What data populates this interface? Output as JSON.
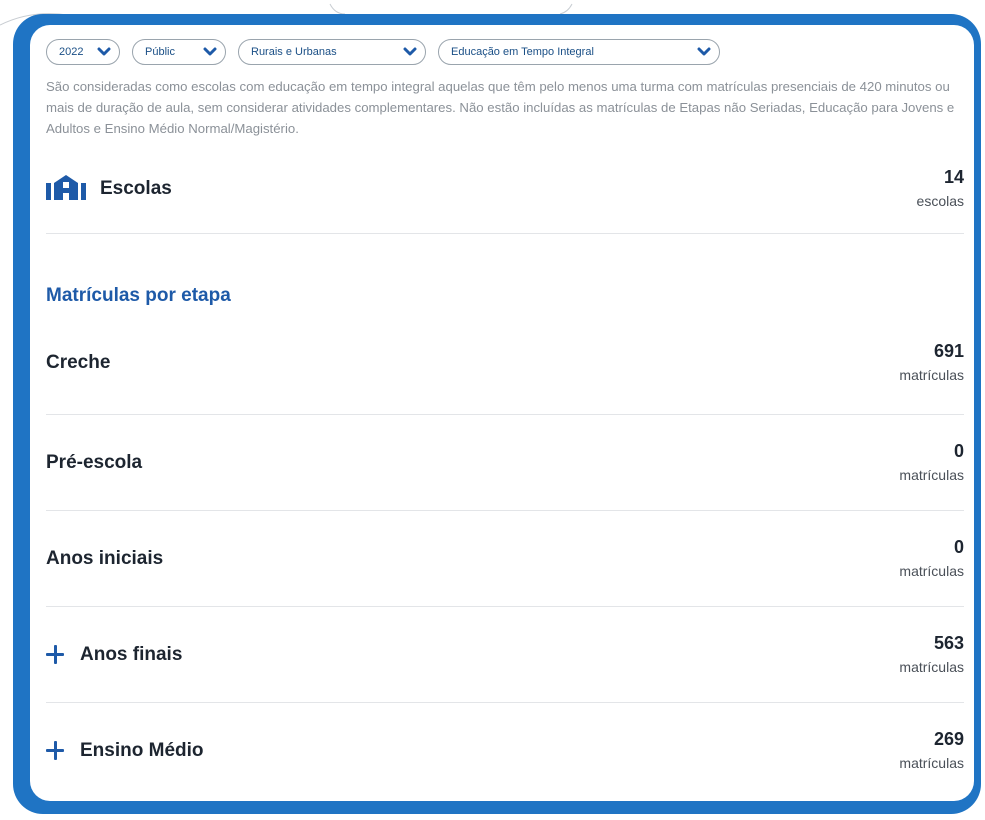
{
  "filters": {
    "year": "2022",
    "network": "Públic",
    "location": "Rurais e Urbanas",
    "modality": "Educação em Tempo Integral"
  },
  "description": "São consideradas como escolas com educação em tempo integral aquelas que têm pelo menos uma turma com matrículas presenciais de 420 minutos ou mais de duração de aula, sem considerar atividades complementares. Não estão incluídas as matrículas de Etapas não Seriadas, Educação para Jovens e Adultos e Ensino Médio Normal/Magistério.",
  "schools": {
    "label": "Escolas",
    "value": "14",
    "unit": "escolas",
    "icon": "school-icon"
  },
  "enrollments": {
    "title": "Matrículas por etapa",
    "unit": "matrículas",
    "stages": [
      {
        "label": "Creche",
        "value": "691",
        "expandable": false
      },
      {
        "label": "Pré-escola",
        "value": "0",
        "expandable": false
      },
      {
        "label": "Anos iniciais",
        "value": "0",
        "expandable": false
      },
      {
        "label": "Anos finais",
        "value": "563",
        "expandable": true
      },
      {
        "label": "Ensino Médio",
        "value": "269",
        "expandable": true
      }
    ]
  },
  "colors": {
    "frame": "#1f74c4",
    "accent": "#1e5aa8",
    "text": "#1d2530",
    "muted": "#8b9198"
  }
}
